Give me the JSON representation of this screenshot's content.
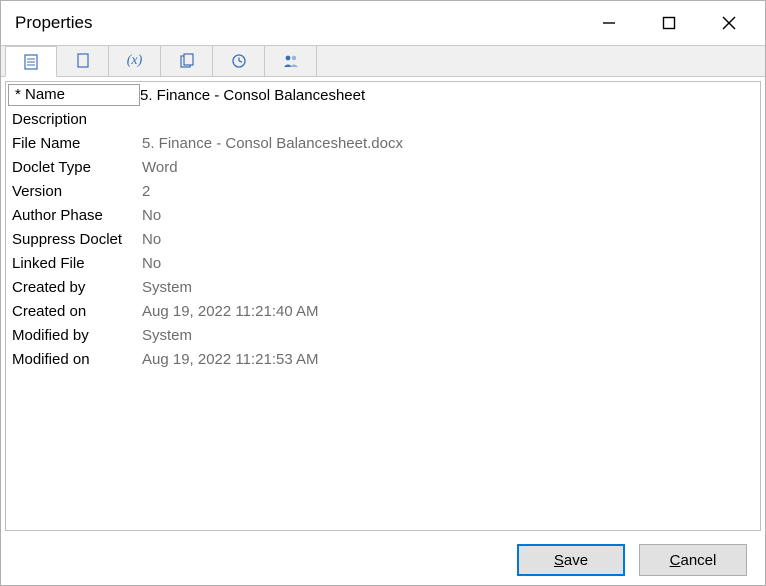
{
  "window": {
    "title": "Properties"
  },
  "tabs": [
    {
      "id": "properties",
      "iconName": "properties-sheet-icon",
      "active": true
    },
    {
      "id": "embedded",
      "iconName": "page-link-icon",
      "active": false
    },
    {
      "id": "variables",
      "iconName": "variable-x-icon",
      "active": false
    },
    {
      "id": "attributes",
      "iconName": "copy-sheet-icon",
      "active": false
    },
    {
      "id": "history",
      "iconName": "clock-icon",
      "active": false
    },
    {
      "id": "actors",
      "iconName": "people-icon",
      "active": false
    }
  ],
  "fields": {
    "name": {
      "label": "* Name",
      "value": "5. Finance - Consol Balancesheet",
      "editable": true
    },
    "description": {
      "label": "Description",
      "value": ""
    },
    "file_name": {
      "label": "File Name",
      "value": "5. Finance - Consol Balancesheet.docx"
    },
    "doclet_type": {
      "label": "Doclet Type",
      "value": "Word"
    },
    "version": {
      "label": "Version",
      "value": "2"
    },
    "author_phase": {
      "label": "Author Phase",
      "value": "No"
    },
    "suppress_doclet": {
      "label": "Suppress Doclet",
      "value": "No"
    },
    "linked_file": {
      "label": "Linked File",
      "value": "No"
    },
    "created_by": {
      "label": "Created by",
      "value": "System"
    },
    "created_on": {
      "label": "Created on",
      "value": "Aug 19, 2022 11:21:40 AM"
    },
    "modified_by": {
      "label": "Modified by",
      "value": "System"
    },
    "modified_on": {
      "label": "Modified on",
      "value": "Aug 19, 2022 11:21:53 AM"
    }
  },
  "buttons": {
    "save": "Save",
    "cancel": "Cancel"
  }
}
